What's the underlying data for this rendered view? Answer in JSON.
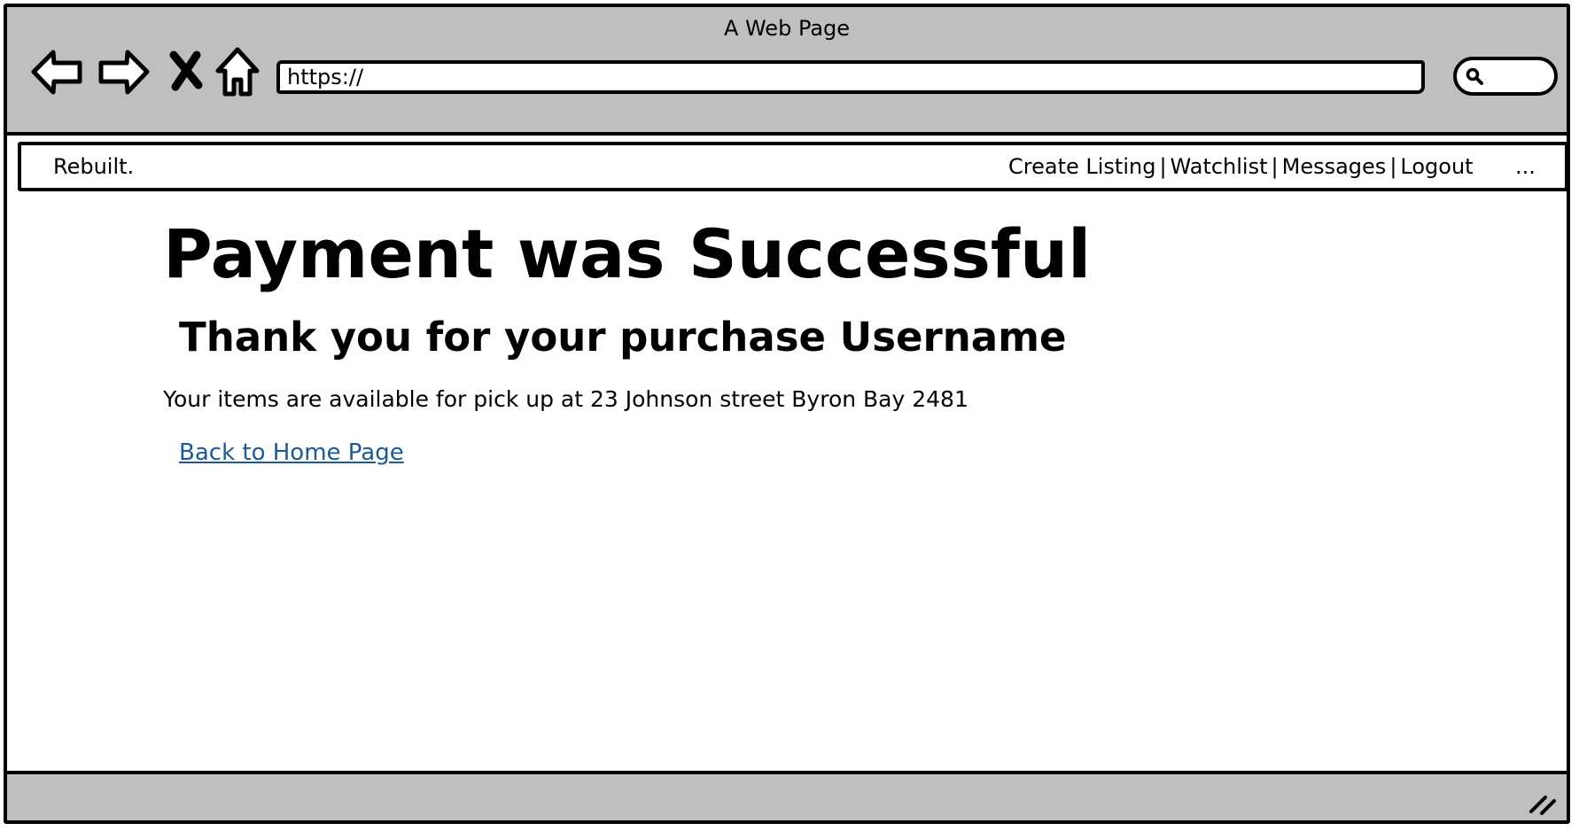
{
  "window": {
    "title": "A Web Page"
  },
  "toolbar": {
    "back_icon": "back-arrow-icon",
    "forward_icon": "forward-arrow-icon",
    "stop_icon": "close-icon",
    "home_icon": "home-icon",
    "url": "https://",
    "search_icon": "search-icon"
  },
  "site_nav": {
    "brand": "Rebuilt.",
    "links": [
      "Create Listing",
      "Watchlist",
      "Messages",
      "Logout"
    ],
    "separator": "|",
    "more": "..."
  },
  "main": {
    "heading": "Payment was Successful",
    "subheading": "Thank you for your purchase Username",
    "info": "Your items are available for pick up at 23 Johnson street Byron Bay 2481",
    "home_link": "Back to Home Page"
  },
  "colors": {
    "chrome": "#bfbfbf",
    "link": "#1a5a96",
    "border": "#000000"
  }
}
